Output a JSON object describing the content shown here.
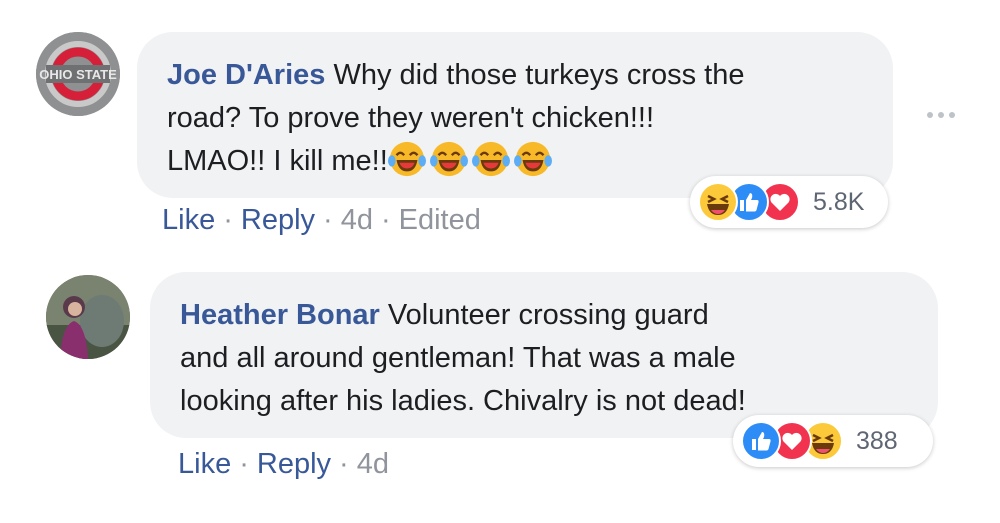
{
  "colors": {
    "author_link": "#385898",
    "bubble_bg": "#f1f2f4",
    "like_blue": "#2e8cf6",
    "love_red": "#f2334f",
    "haha_yellow": "#fbc93a",
    "meta_gray": "#90949c"
  },
  "comments": [
    {
      "author": "Joe D'Aries",
      "avatar": "ohio-state-logo-avatar",
      "text_lines": [
        "Why did those turkeys cross the",
        "road? To prove they weren't chicken!!!",
        "LMAO!! I kill me!!"
      ],
      "emoji": [
        "joy-emoji",
        "joy-emoji",
        "joy-emoji",
        "joy-emoji"
      ],
      "reactions": {
        "icons": [
          "haha-icon",
          "like-icon",
          "love-icon"
        ],
        "count": "5.8K"
      },
      "actions": {
        "like": "Like",
        "reply": "Reply",
        "time": "4d",
        "edited": "Edited",
        "sep": "·"
      }
    },
    {
      "author": "Heather Bonar",
      "avatar": "profile-photo-avatar",
      "text_lines": [
        "Volunteer crossing guard",
        "and all around gentleman! That was a male",
        "looking after his ladies. Chivalry is not dead!"
      ],
      "reactions": {
        "icons": [
          "like-icon",
          "love-icon",
          "haha-icon"
        ],
        "count": "388"
      },
      "actions": {
        "like": "Like",
        "reply": "Reply",
        "time": "4d",
        "sep": "·"
      }
    }
  ]
}
